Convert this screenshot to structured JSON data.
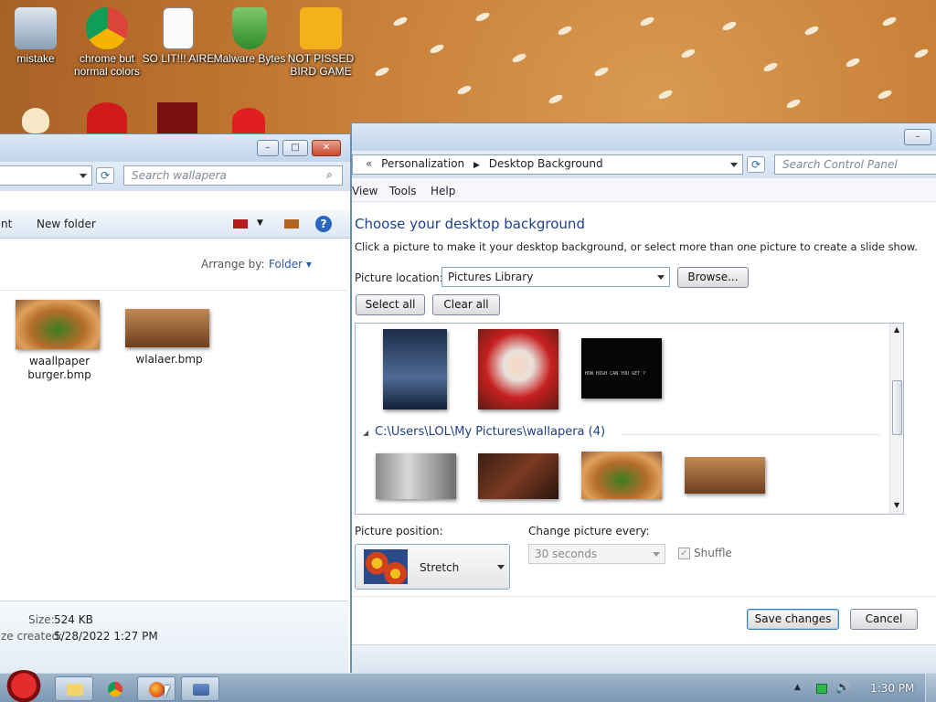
{
  "desktop": {
    "icons": [
      {
        "label": "mistake"
      },
      {
        "label": "chrome but normal colors"
      },
      {
        "label": "SO LIT!!! AIRE"
      },
      {
        "label": "Malware Bytes"
      },
      {
        "label": "NOT PISSED BIRD GAME"
      }
    ]
  },
  "explorer": {
    "search_placeholder": "Search wallapera",
    "toolbar": {
      "cut_label": "nt",
      "new_folder": "New folder"
    },
    "arrange_label": "Arrange by:",
    "arrange_value": "Folder",
    "files": [
      {
        "name": "waallpaper burger.bmp"
      },
      {
        "name": "wlalaer.bmp"
      }
    ],
    "details": {
      "size_label": "Size:",
      "size_value": "524 KB",
      "created_label": "ze created:",
      "created_value": "5/28/2022 1:27 PM"
    }
  },
  "control_panel": {
    "breadcrumb": [
      "Personalization",
      "Desktop Background"
    ],
    "search_placeholder": "Search Control Panel",
    "menu": [
      "View",
      "Tools",
      "Help"
    ],
    "heading": "Choose your desktop background",
    "instruction": "Click a picture to make it your desktop background, or select more than one picture to create a slide show.",
    "picture_location_label": "Picture location:",
    "picture_location_value": "Pictures Library",
    "browse_label": "Browse...",
    "select_all_label": "Select all",
    "clear_all_label": "Clear all",
    "game_text": "HOW HIGH CAN YOU GET ?",
    "group_label": "C:\\Users\\LOL\\My Pictures\\wallapera (4)",
    "picture_position_label": "Picture position:",
    "picture_position_value": "Stretch",
    "change_every_label": "Change picture every:",
    "change_every_value": "30 seconds",
    "shuffle_label": "Shuffle",
    "save_label": "Save changes",
    "cancel_label": "Cancel"
  },
  "taskbar": {
    "clock": "1:30 PM"
  }
}
